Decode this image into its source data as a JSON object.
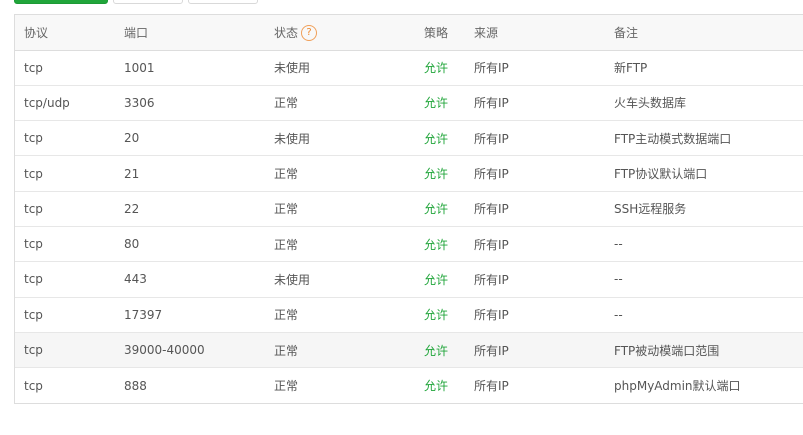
{
  "toolbar": {
    "buttons": [
      {
        "label": "",
        "style": "primary"
      },
      {
        "label": "",
        "style": "default"
      },
      {
        "label": "",
        "style": "default"
      }
    ]
  },
  "table": {
    "headers": {
      "protocol": "协议",
      "port": "端口",
      "status": "状态",
      "status_help_icon": "?",
      "policy": "策略",
      "source": "来源",
      "remark": "备注"
    },
    "rows": [
      {
        "protocol": "tcp",
        "port": "1001",
        "status": "未使用",
        "policy": "允许",
        "source": "所有IP",
        "remark": "新FTP"
      },
      {
        "protocol": "tcp/udp",
        "port": "3306",
        "status": "正常",
        "policy": "允许",
        "source": "所有IP",
        "remark": "火车头数据库"
      },
      {
        "protocol": "tcp",
        "port": "20",
        "status": "未使用",
        "policy": "允许",
        "source": "所有IP",
        "remark": "FTP主动模式数据端口"
      },
      {
        "protocol": "tcp",
        "port": "21",
        "status": "正常",
        "policy": "允许",
        "source": "所有IP",
        "remark": "FTP协议默认端口"
      },
      {
        "protocol": "tcp",
        "port": "22",
        "status": "正常",
        "policy": "允许",
        "source": "所有IP",
        "remark": "SSH远程服务"
      },
      {
        "protocol": "tcp",
        "port": "80",
        "status": "正常",
        "policy": "允许",
        "source": "所有IP",
        "remark": "--"
      },
      {
        "protocol": "tcp",
        "port": "443",
        "status": "未使用",
        "policy": "允许",
        "source": "所有IP",
        "remark": "--"
      },
      {
        "protocol": "tcp",
        "port": "17397",
        "status": "正常",
        "policy": "允许",
        "source": "所有IP",
        "remark": "--"
      },
      {
        "protocol": "tcp",
        "port": "39000-40000",
        "status": "正常",
        "policy": "允许",
        "source": "所有IP",
        "remark": "FTP被动模端口范围"
      },
      {
        "protocol": "tcp",
        "port": "888",
        "status": "正常",
        "policy": "允许",
        "source": "所有IP",
        "remark": "phpMyAdmin默认端口"
      }
    ],
    "highlighted_row": 8
  },
  "colors": {
    "accent_green": "#20a53a",
    "help_icon_orange": "#f0882d"
  }
}
